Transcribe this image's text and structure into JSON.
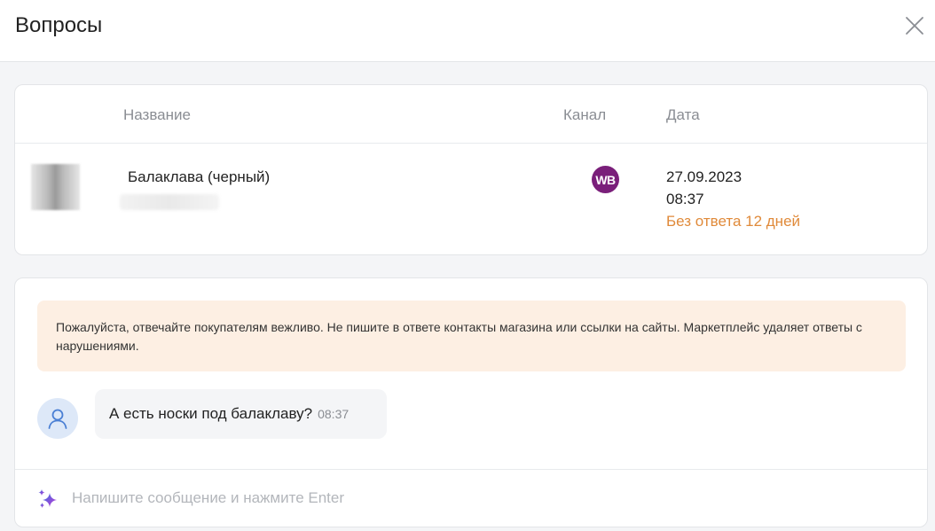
{
  "header": {
    "title": "Вопросы",
    "close_icon": "close-icon"
  },
  "table": {
    "columns": {
      "name": "Название",
      "channel": "Канал",
      "date": "Дата"
    },
    "row": {
      "product_name": "Балаклава (черный)",
      "channel_badge": "WB",
      "channel_color": "#7a1f7a",
      "date": "27.09.2023",
      "time": "08:37",
      "status": "Без ответа 12 дней",
      "status_color": "#e08a3a"
    }
  },
  "chat": {
    "notice": "Пожалуйста, отвечайте покупателям вежливо. Не пишите в ответе контакты магазина или ссылки на сайты. Маркетплейс удаляет ответы с нарушениями.",
    "notice_bg": "#fdefe3",
    "message": {
      "avatar_icon": "user-icon",
      "text": "А есть носки под балаклаву?",
      "time": "08:37"
    },
    "input": {
      "placeholder": "Напишите сообщение и нажмите Enter",
      "value": "",
      "icon": "sparkle-icon"
    }
  }
}
